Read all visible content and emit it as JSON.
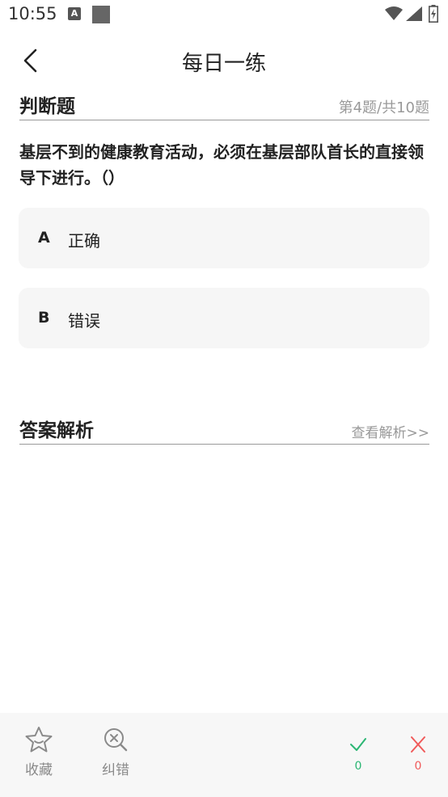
{
  "status_bar": {
    "time": "10:55",
    "notification_letter": "A"
  },
  "header": {
    "title": "每日一练"
  },
  "question_section": {
    "type_label": "判断题",
    "progress": "第4题/共10题"
  },
  "question": {
    "text": "基层不到的健康教育活动，必须在基层部队首长的直接领导下进行。（）"
  },
  "options": [
    {
      "letter": "A",
      "text": "正确"
    },
    {
      "letter": "B",
      "text": "错误"
    }
  ],
  "analysis_section": {
    "title": "答案解析",
    "view_link": "查看解析>>"
  },
  "bottom_bar": {
    "favorite_label": "收藏",
    "report_label": "纠错",
    "correct_count": "0",
    "wrong_count": "0",
    "colors": {
      "correct": "#2bb673",
      "wrong": "#f05a5a"
    }
  }
}
